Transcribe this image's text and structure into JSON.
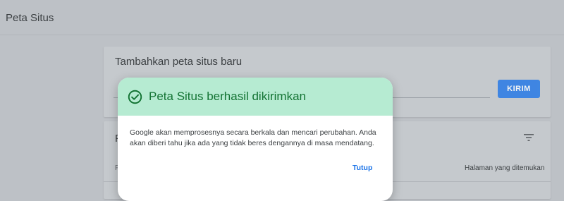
{
  "page": {
    "title": "Peta Situs"
  },
  "add_sitemap": {
    "title": "Tambahkan peta situs baru",
    "url_value": "",
    "submit_label": "KIRIM"
  },
  "submitted_list": {
    "title": "P",
    "column_left": "F",
    "column_right": "Halaman yang ditemukan"
  },
  "dialog": {
    "title": "Peta Situs berhasil dikirimkan",
    "body": "Google akan memproses­nya secara berkala dan mencari perubahan. Anda akan diberi tahu jika ada yang tidak beres dengannya di masa mendatang.",
    "close_label": "Tutup",
    "accent_color": "#137333",
    "header_color": "#b6ebd2",
    "link_color": "#1a73e8"
  },
  "icons": {
    "dialog_status": "check-circle-icon",
    "list_filter": "filter-icon"
  }
}
